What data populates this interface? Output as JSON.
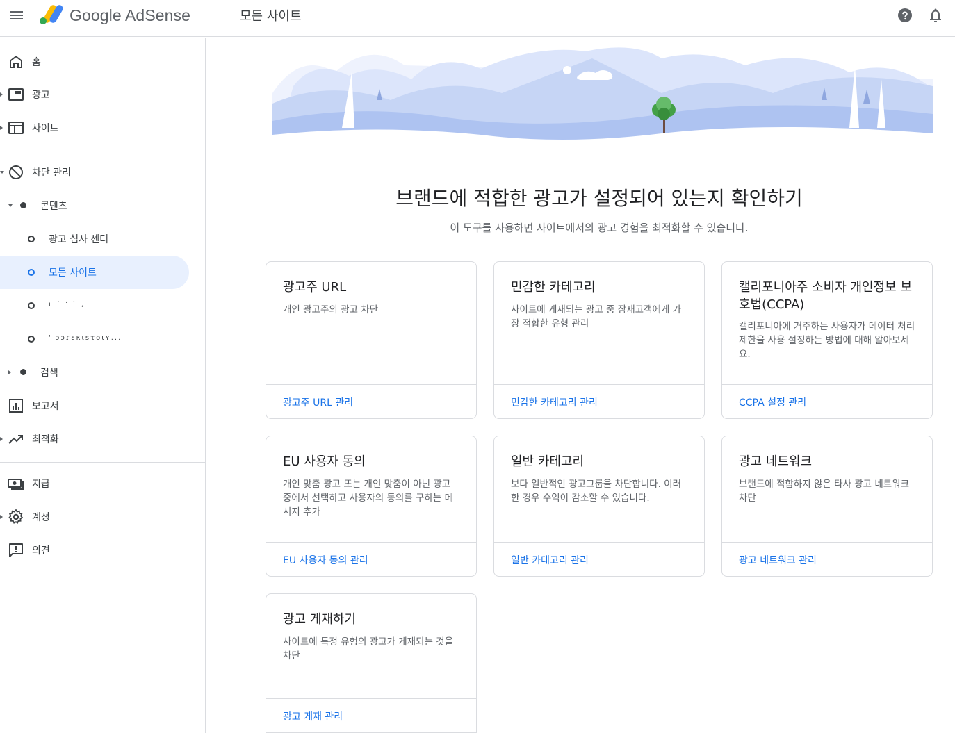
{
  "header": {
    "brand": "Google AdSense",
    "page_title": "모든 사이트"
  },
  "sidebar": {
    "items": [
      {
        "label": "홈",
        "icon": "home-icon"
      },
      {
        "label": "광고",
        "icon": "ad-unit-icon"
      },
      {
        "label": "사이트",
        "icon": "web-icon"
      },
      {
        "label": "차단 관리",
        "icon": "block-icon"
      },
      {
        "label": "보고서",
        "icon": "bar-chart-icon"
      },
      {
        "label": "최적화",
        "icon": "trending-up-icon"
      },
      {
        "label": "지급",
        "icon": "payments-icon"
      },
      {
        "label": "계정",
        "icon": "gear-icon"
      },
      {
        "label": "의견",
        "icon": "feedback-icon"
      }
    ],
    "content": {
      "label": "콘텐츠",
      "children": [
        {
          "label": "광고 심사 센터"
        },
        {
          "label": "모든 사이트"
        },
        {
          "label": "ʟ           ` ʻ `        ,"
        },
        {
          "label": "'     ɔɔɾɛκιsτοιʏ..."
        }
      ]
    },
    "search": {
      "label": "검색"
    }
  },
  "main": {
    "headline": "브랜드에 적합한 광고가 설정되어 있는지 확인하기",
    "subline": "이 도구를 사용하면 사이트에서의 광고 경험을 최적화할 수 있습니다.",
    "cards": [
      {
        "title": "광고주 URL",
        "desc": "개인 광고주의 광고 차단",
        "link": "광고주 URL 관리"
      },
      {
        "title": "민감한 카테고리",
        "desc": "사이트에 게재되는 광고 중 잠재고객에게 가장 적합한 유형 관리",
        "link": "민감한 카테고리 관리"
      },
      {
        "title": "캘리포니아주 소비자 개인정보 보호법(CCPA)",
        "desc": "캘리포니아에 거주하는 사용자가 데이터 처리 제한을 사용 설정하는 방법에 대해 알아보세요.",
        "link": "CCPA 설정 관리"
      },
      {
        "title": "EU 사용자 동의",
        "desc": "개인 맞춤 광고 또는 개인 맞춤이 아닌 광고 중에서 선택하고 사용자의 동의를 구하는 메시지 추가",
        "link": "EU 사용자 동의 관리"
      },
      {
        "title": "일반 카테고리",
        "desc": "보다 일반적인 광고그룹을 차단합니다. 이러한 경우 수익이 감소할 수 있습니다.",
        "link": "일반 카테고리 관리"
      },
      {
        "title": "광고 네트워크",
        "desc": "브랜드에 적합하지 않은 타사 광고 네트워크 차단",
        "link": "광고 네트워크 관리"
      },
      {
        "title": "광고 게재하기",
        "desc": "사이트에 특정 유형의 광고가 게재되는 것을 차단",
        "link": "광고 게재 관리"
      }
    ]
  },
  "colors": {
    "accent": "#1a73e8",
    "active_bg": "#e8f0fe",
    "border": "#dadce0",
    "hero_light": "#e8eefc",
    "hero_mid": "#c6d5f5",
    "hero_dark": "#a9c0ef"
  }
}
